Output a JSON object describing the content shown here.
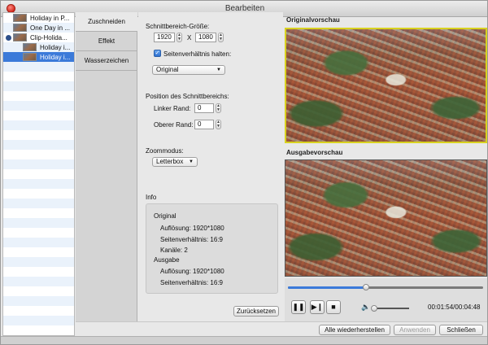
{
  "window": {
    "title": "Bearbeiten"
  },
  "files": [
    {
      "label": "Holiday in P...",
      "level": 0
    },
    {
      "label": "One Day in ...",
      "level": 0
    },
    {
      "label": "Clip-Holida...",
      "level": 0
    },
    {
      "label": "Holiday i...",
      "level": 1
    },
    {
      "label": "Holiday i...",
      "level": 1,
      "selected": true
    }
  ],
  "tabs": [
    {
      "label": "Zuschneiden",
      "active": true
    },
    {
      "label": "Effekt",
      "active": false
    },
    {
      "label": "Wasserzeichen",
      "active": false
    }
  ],
  "crop": {
    "section_title": "Schnittbereich-Größe:",
    "width": "1920",
    "x_sep": "X",
    "height": "1080",
    "keep_ratio_label": "Seitenverhältnis halten:",
    "keep_ratio_checked": true,
    "ratio_value": "Original",
    "position_title": "Position des Schnittbereichs:",
    "left_label": "Linker Rand:",
    "left_value": "0",
    "top_label": "Oberer Rand:",
    "top_value": "0",
    "zoom_title": "Zoommodus:",
    "zoom_value": "Letterbox"
  },
  "info": {
    "title": "Info",
    "original_heading": "Original",
    "original_resolution": "Auflösung: 1920*1080",
    "original_ratio": "Seitenverhältnis: 16:9",
    "original_channels": "Kanäle: 2",
    "output_heading": "Ausgabe",
    "output_resolution": "Auflösung: 1920*1080",
    "output_ratio": "Seitenverhältnis: 16:9"
  },
  "reset_label": "Zurücksetzen",
  "preview": {
    "original_label": "Originalvorschau",
    "output_label": "Ausgabevorschau"
  },
  "player": {
    "progress_fraction": 0.4,
    "volume_fraction": 0.0,
    "timecode": "00:01:54/00:04:48"
  },
  "buttons": {
    "restore_all": "Alle wiederherstellen",
    "apply": "Anwenden",
    "close": "Schließen"
  }
}
